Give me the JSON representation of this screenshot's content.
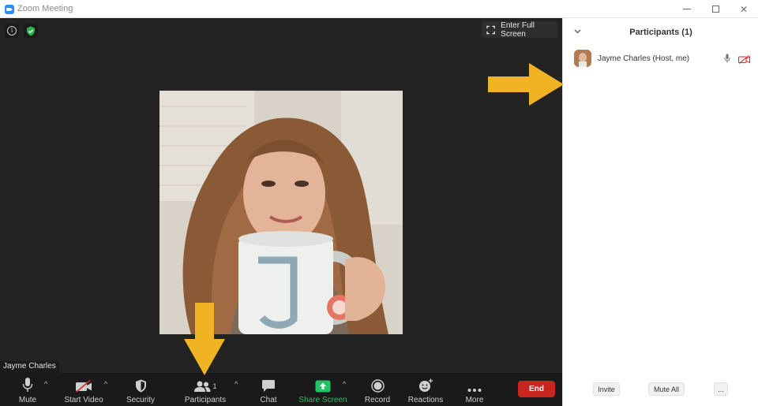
{
  "window": {
    "title": "Zoom Meeting"
  },
  "video": {
    "fullscreen_label": "Enter Full Screen",
    "self_name": "Jayme Charles"
  },
  "toolbar": {
    "mute_label": "Mute",
    "start_video_label": "Start Video",
    "security_label": "Security",
    "participants_label": "Participants",
    "participants_count": "1",
    "chat_label": "Chat",
    "share_screen_label": "Share Screen",
    "record_label": "Record",
    "reactions_label": "Reactions",
    "more_label": "More",
    "end_label": "End"
  },
  "panel": {
    "title": "Participants (1)",
    "participants": [
      {
        "name": "Jayme Charles (Host, me)"
      }
    ],
    "invite_label": "Invite",
    "mute_all_label": "Mute All",
    "more_label": "..."
  },
  "colors": {
    "toolbar_bg": "#1a1a1a",
    "video_bg": "#232323",
    "end_button": "#c8251f",
    "share_green": "#26c165",
    "annotation_arrow": "#f0b323",
    "zoom_blue": "#2d8cff"
  }
}
